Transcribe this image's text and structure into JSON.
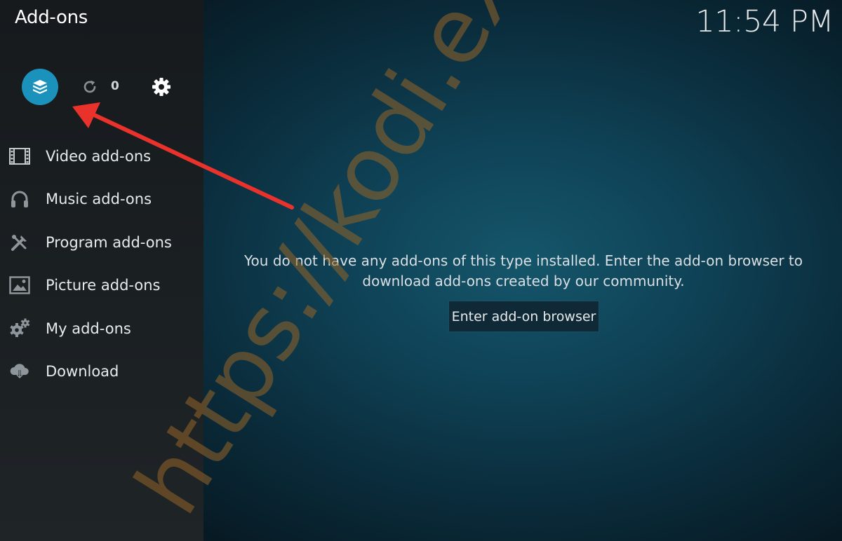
{
  "header": {
    "title": "Add-ons",
    "clock": "11:54 PM"
  },
  "toolbar": {
    "addon_browser_icon": "open-box-icon",
    "update_count": "0",
    "refresh_icon": "refresh-icon",
    "settings_icon": "gear-icon",
    "accent_color": "#1b92bc"
  },
  "sidebar": {
    "items": [
      {
        "label": "Video add-ons",
        "icon": "film-icon"
      },
      {
        "label": "Music add-ons",
        "icon": "headphones-icon"
      },
      {
        "label": "Program add-ons",
        "icon": "tools-icon"
      },
      {
        "label": "Picture add-ons",
        "icon": "picture-icon"
      },
      {
        "label": "My add-ons",
        "icon": "gears-icon"
      },
      {
        "label": "Download",
        "icon": "cloud-download-icon"
      }
    ]
  },
  "main": {
    "message": "You do not have any add-ons of this type installed. Enter the add-on browser to download add-ons created by our community.",
    "button_label": "Enter add-on browser"
  },
  "watermark": {
    "text": "https://kodi.expert"
  },
  "annotation": {
    "arrow_color": "#e8322b"
  }
}
